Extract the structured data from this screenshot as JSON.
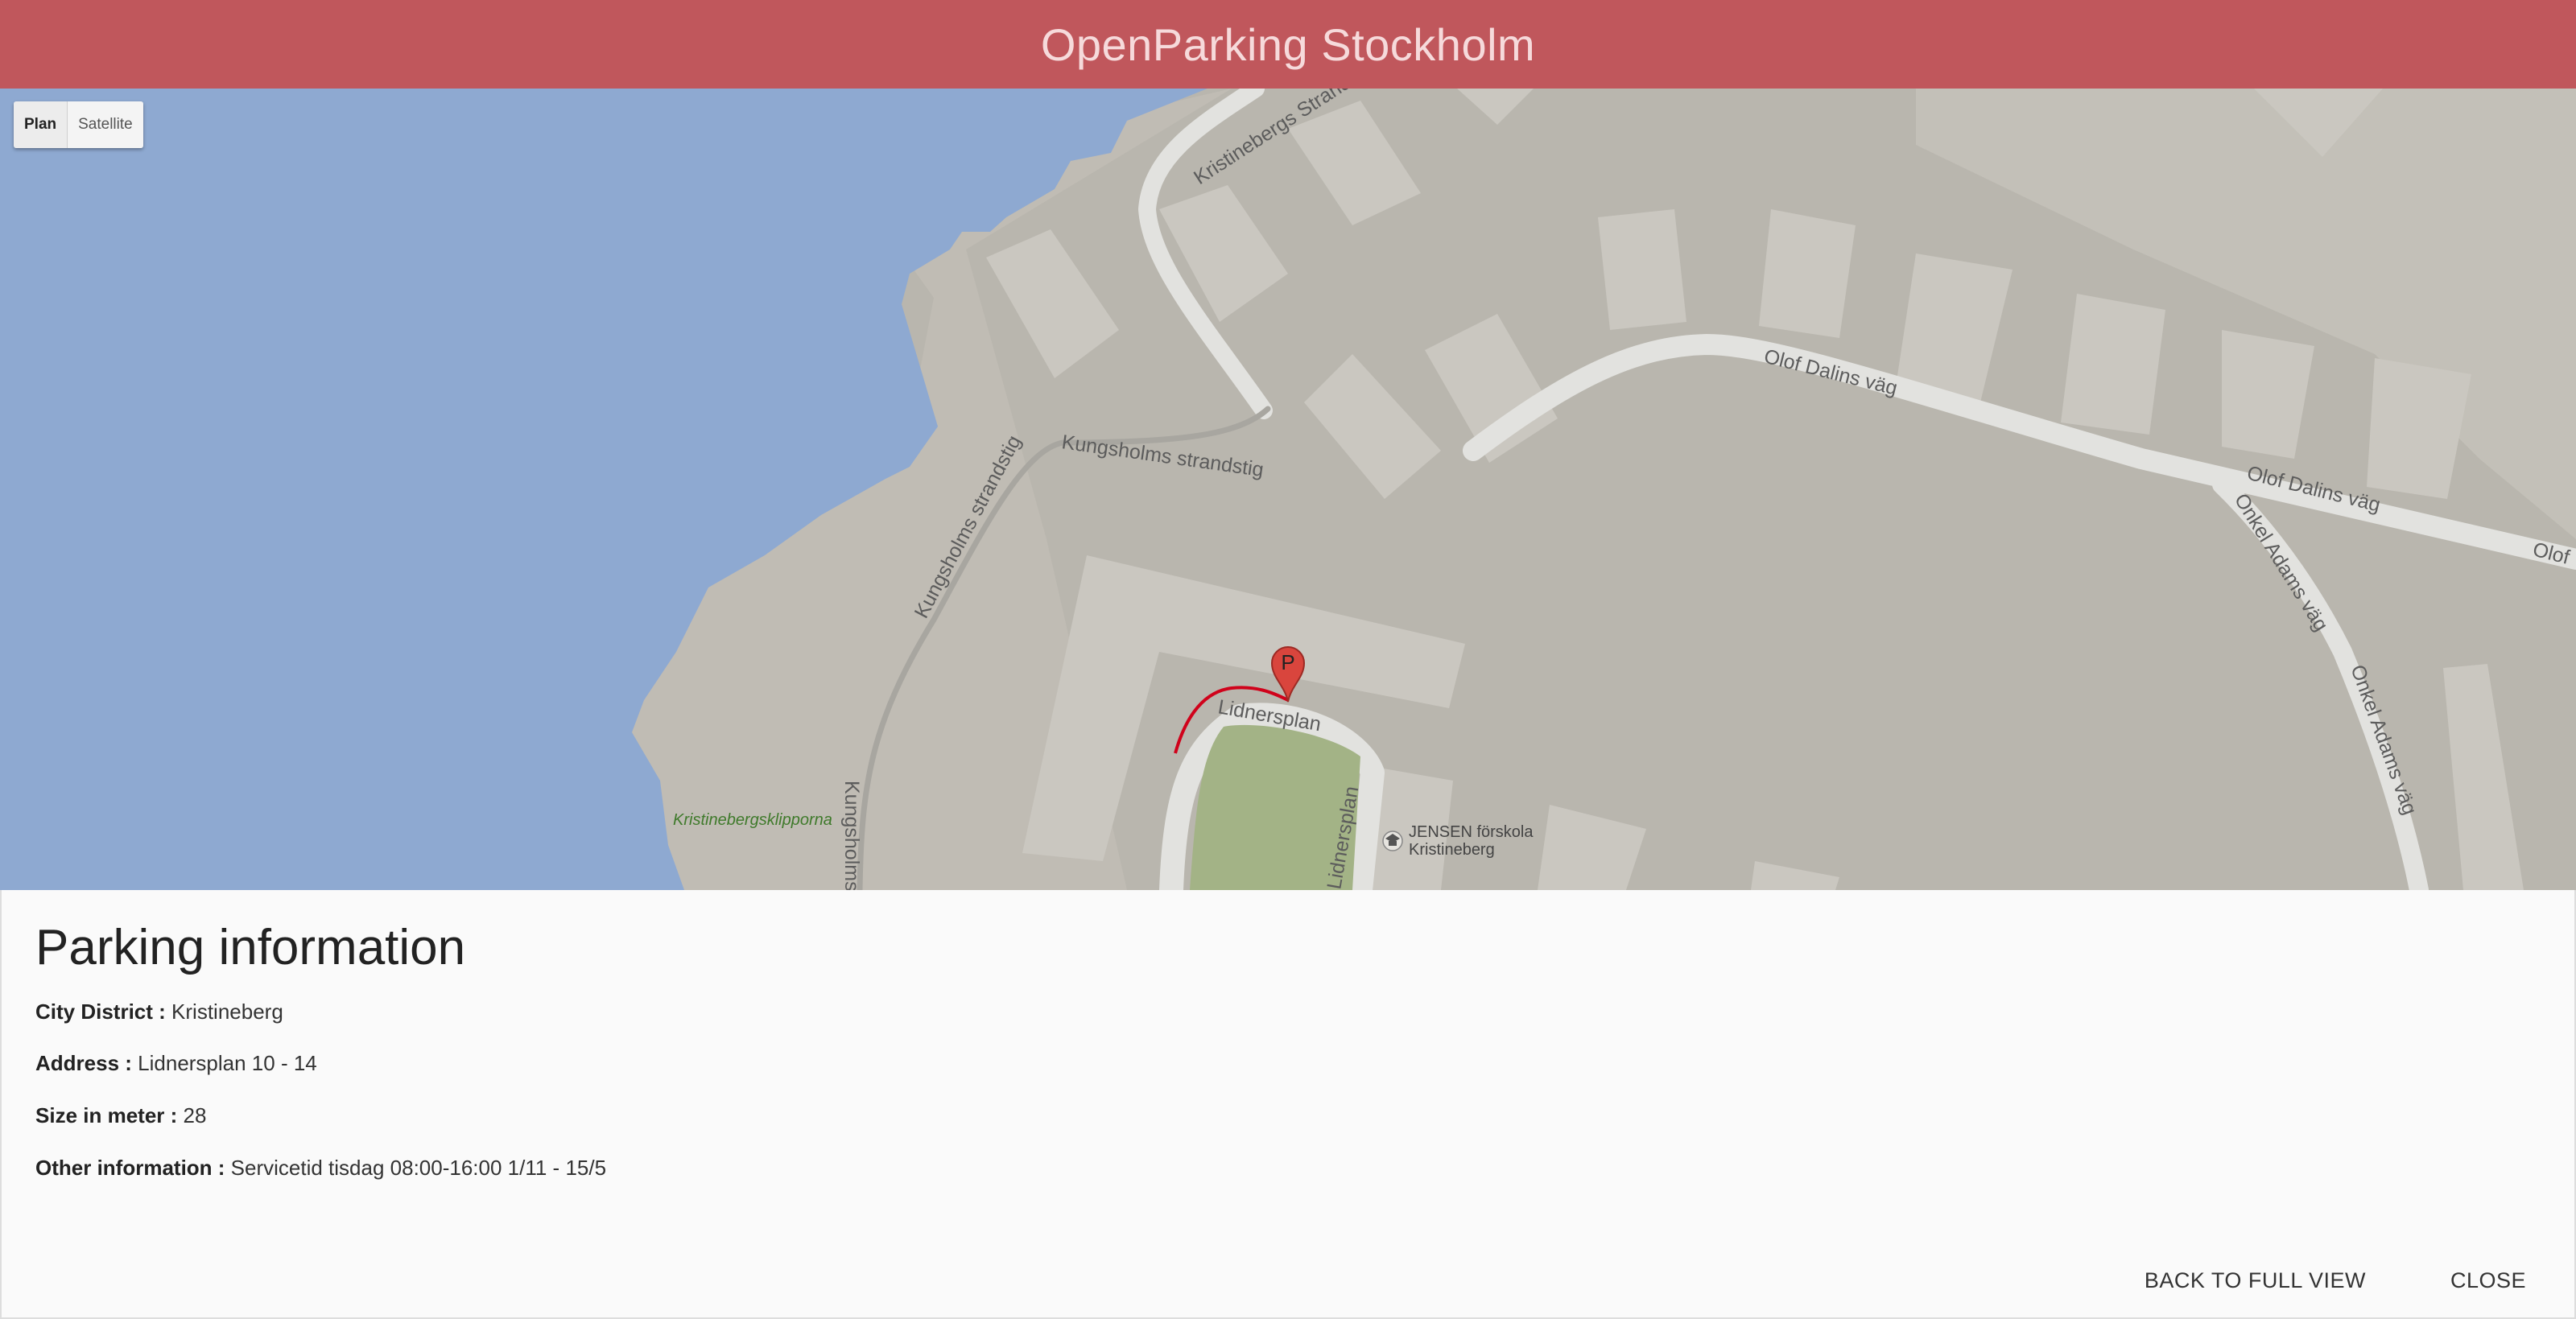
{
  "app": {
    "title": "OpenParking Stockholm"
  },
  "map": {
    "type_buttons": [
      {
        "label": "Plan",
        "active": true
      },
      {
        "label": "Satellite",
        "active": false
      }
    ],
    "labels": {
      "kristinebergs_strand": "Kristinebergs Strand",
      "kungsholms_strandstig_a": "Kungsholms strandstig",
      "kungsholms_strandstig_b": "Kungsholms strandstig",
      "kungsholms_strandstig_c": "Kungsholms",
      "olof_dalins_1": "Olof Dalins väg",
      "olof_dalins_2": "Olof Dalins väg",
      "olof_dalins_3": "Olof",
      "onkel_adams_1": "Onkel Adams väg",
      "onkel_adams_2": "Onkel Adams väg",
      "lidnersplan_1": "Lidnersplan",
      "lidnersplan_2": "Lidnersplan",
      "park": "Kristinebergsklipporna",
      "poi_line1": "JENSEN förskola",
      "poi_line2": "Kristineberg"
    },
    "marker_letter": "P",
    "colors": {
      "water": "#8ea9d1",
      "land": "#bebbb3",
      "road": "#e1e1df",
      "park": "#a3b386",
      "parking_line": "#d0021b",
      "marker": "#d9453d"
    }
  },
  "panel": {
    "title": "Parking information",
    "rows": [
      {
        "key": "City District :",
        "value": "Kristineberg"
      },
      {
        "key": "Address :",
        "value": "Lidnersplan 10 - 14"
      },
      {
        "key": "Size in meter :",
        "value": "28"
      },
      {
        "key": "Other information :",
        "value": "Servicetid tisdag 08:00-16:00 1/11 - 15/5"
      }
    ],
    "actions": {
      "back": "Back to full view",
      "close": "Close"
    }
  }
}
